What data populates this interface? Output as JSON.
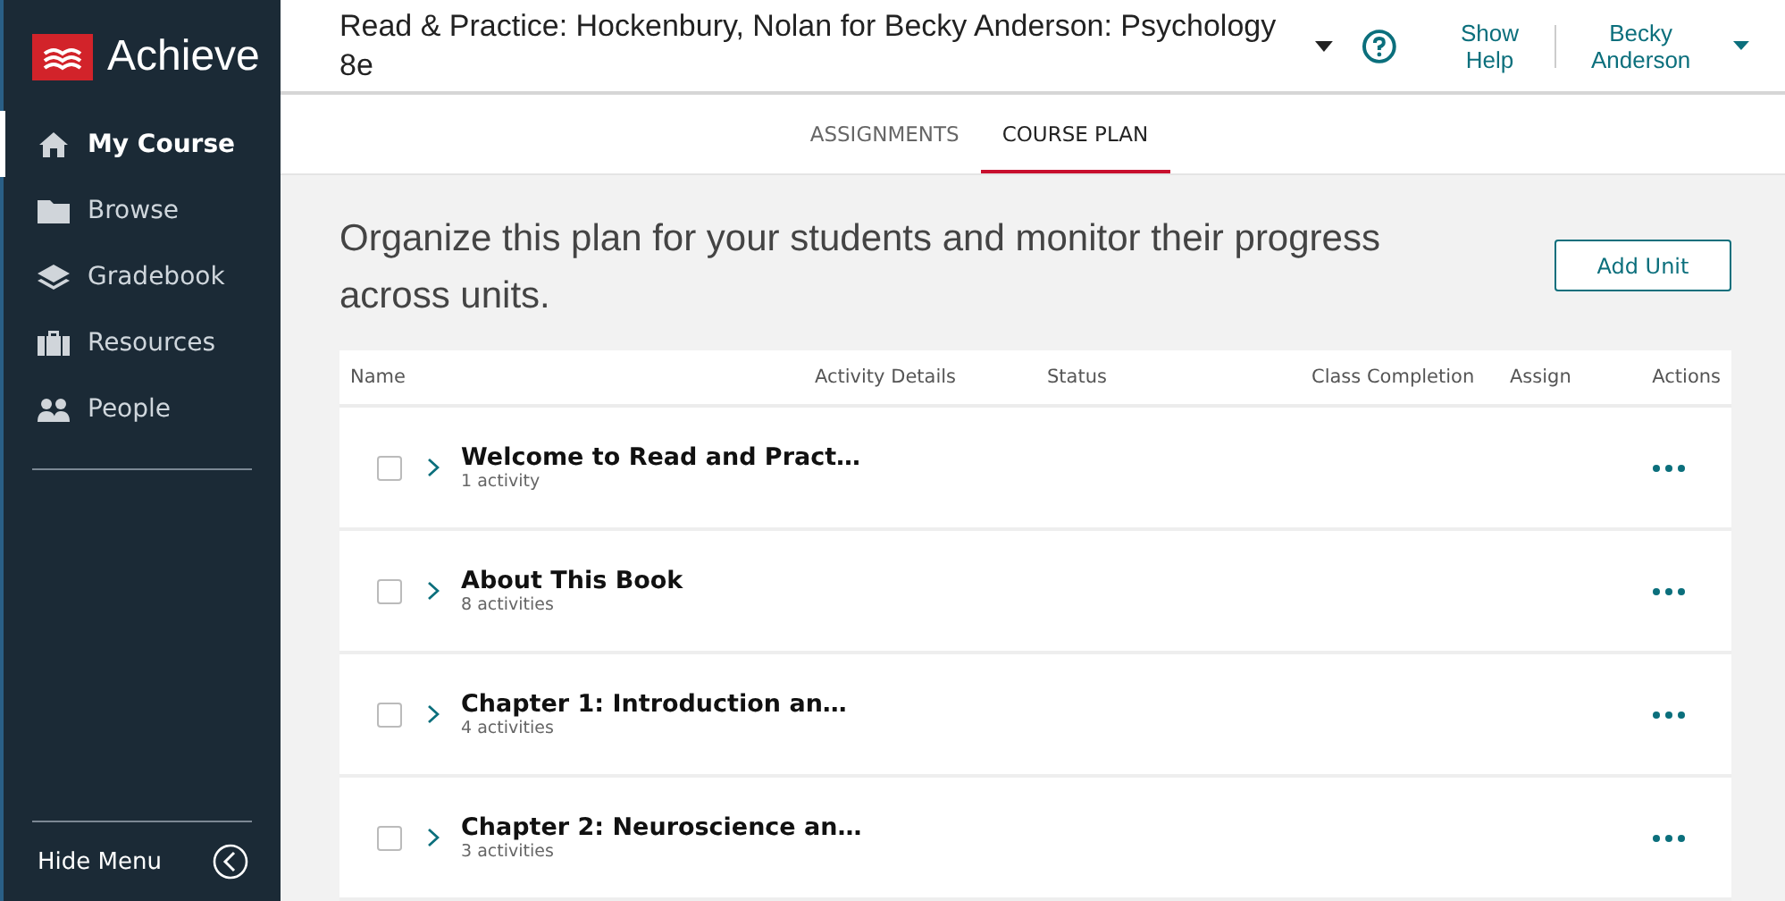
{
  "sidebar": {
    "logo": "Achieve",
    "items": [
      {
        "label": "My Course",
        "kind": "home",
        "selected": true
      },
      {
        "label": "Browse",
        "kind": "folder",
        "selected": false
      },
      {
        "label": "Gradebook",
        "kind": "layers",
        "selected": false
      },
      {
        "label": "Resources",
        "kind": "briefcase",
        "selected": false
      },
      {
        "label": "People",
        "kind": "people",
        "selected": false
      }
    ],
    "hide_menu": "Hide Menu"
  },
  "header": {
    "title": "Read & Practice: Hockenbury, Nolan for Becky Anderson: Psychology 8e",
    "show_help": "Show Help",
    "user": "Becky Anderson"
  },
  "tabs": [
    {
      "label": "ASSIGNMENTS",
      "selected": false
    },
    {
      "label": "COURSE PLAN",
      "selected": true
    }
  ],
  "intro": "Organize this plan for your students and monitor their progress across units.",
  "add_unit": "Add Unit",
  "table": {
    "columns": [
      "Name",
      "Activity Details",
      "Status",
      "Class Completion",
      "Assign",
      "Actions"
    ],
    "rows": [
      {
        "title": "Welcome to Read and Pract…",
        "count": "1 activity",
        "checked": false
      },
      {
        "title": "About This Book",
        "count": "8 activities",
        "checked": false
      },
      {
        "title": "Chapter 1: Introduction an…",
        "count": "4 activities",
        "checked": false
      },
      {
        "title": "Chapter 2: Neuroscience an…",
        "count": "3 activities",
        "checked": false
      }
    ]
  }
}
